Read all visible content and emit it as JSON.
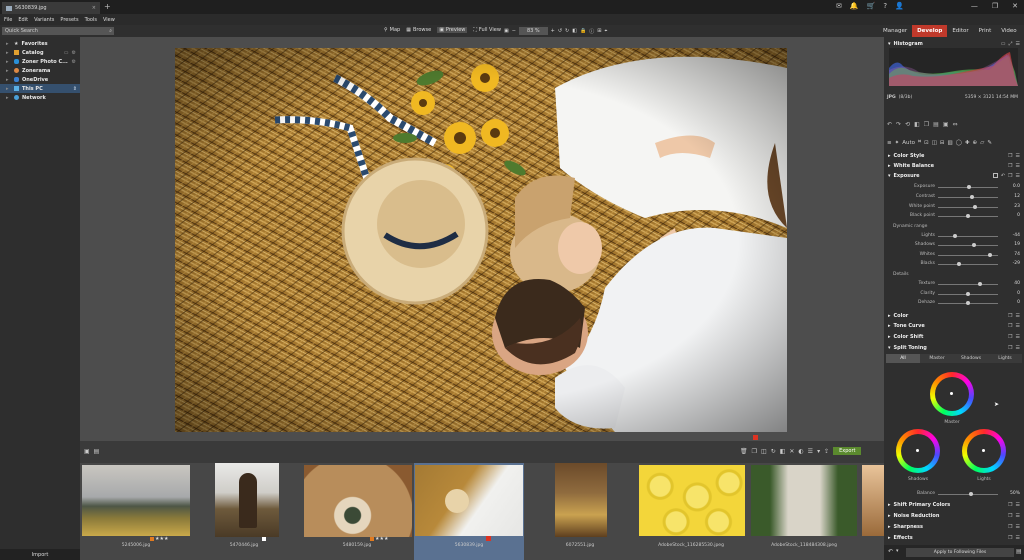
{
  "tab": {
    "title": "5630839.jpg",
    "close": "×",
    "add": "+"
  },
  "window": {
    "minimize": "—",
    "maximize": "❐",
    "close": "✕"
  },
  "menu": [
    "File",
    "Edit",
    "Variants",
    "Presets",
    "Tools",
    "View"
  ],
  "toolbar": {
    "search_placeholder": "Quick Search",
    "views": [
      "Map",
      "Browse",
      "Preview",
      "Full View"
    ],
    "zoom": "83 %"
  },
  "modes": [
    "Manager",
    "Develop",
    "Editor",
    "Print",
    "Video"
  ],
  "sidebar": {
    "items": [
      "Favorites",
      "Catalog",
      "Zoner Photo C...",
      "Zonerama",
      "OneDrive",
      "This PC",
      "Network"
    ],
    "import": "Import"
  },
  "filmstrip": {
    "export": "Export",
    "thumbs": [
      {
        "name": "5245006.jpg",
        "stars": "★★★"
      },
      {
        "name": "5470446.jpg",
        "stars": ""
      },
      {
        "name": "5480159.jpg",
        "stars": "★★★"
      },
      {
        "name": "5630839.jpg",
        "stars": ""
      },
      {
        "name": "6072551.jpg",
        "stars": ""
      },
      {
        "name": "AdobeStock_116285530.jpeg",
        "stars": ""
      },
      {
        "name": "AdobeStock_118484308.jpeg",
        "stars": ""
      }
    ]
  },
  "panel": {
    "histogram": "Histogram",
    "file_format": "JPG",
    "file_bits": "(8/3b)",
    "file_info": "5359 × 3121  14:54 MM",
    "auto": "Auto",
    "sections_top": [
      "Color Style",
      "White Balance",
      "Exposure"
    ],
    "exposure": [
      {
        "label": "Exposure",
        "value": "0.0",
        "pos": 0.52
      },
      {
        "label": "Contrast",
        "value": "12",
        "pos": 0.56
      },
      {
        "label": "White point",
        "value": "23",
        "pos": 0.62
      },
      {
        "label": "Black point",
        "value": "0",
        "pos": 0.5
      }
    ],
    "dynamic_range": "Dynamic range",
    "dynamic": [
      {
        "label": "Lights",
        "value": "-44",
        "pos": 0.28
      },
      {
        "label": "Shadows",
        "value": "19",
        "pos": 0.6
      },
      {
        "label": "Whites",
        "value": "74",
        "pos": 0.87
      },
      {
        "label": "Blacks",
        "value": "-29",
        "pos": 0.35
      }
    ],
    "details": "Details",
    "detail": [
      {
        "label": "Texture",
        "value": "40",
        "pos": 0.7
      },
      {
        "label": "Clarity",
        "value": "0",
        "pos": 0.5
      },
      {
        "label": "Dehaze",
        "value": "0",
        "pos": 0.5
      }
    ],
    "sections_mid": [
      "Color",
      "Tone Curve",
      "Color Shift",
      "Split Toning"
    ],
    "split_tabs": [
      "All",
      "Master",
      "Shadows",
      "Lights"
    ],
    "wheels": {
      "master": "Master",
      "shadows": "Shadows",
      "lights": "Lights"
    },
    "balance": {
      "label": "Balance",
      "value": "50%",
      "pos": 0.55
    },
    "sections_bottom": [
      "Shift Primary Colors",
      "Noise Reduction",
      "Sharpness",
      "Effects"
    ],
    "apply": "Apply to Following Files"
  }
}
